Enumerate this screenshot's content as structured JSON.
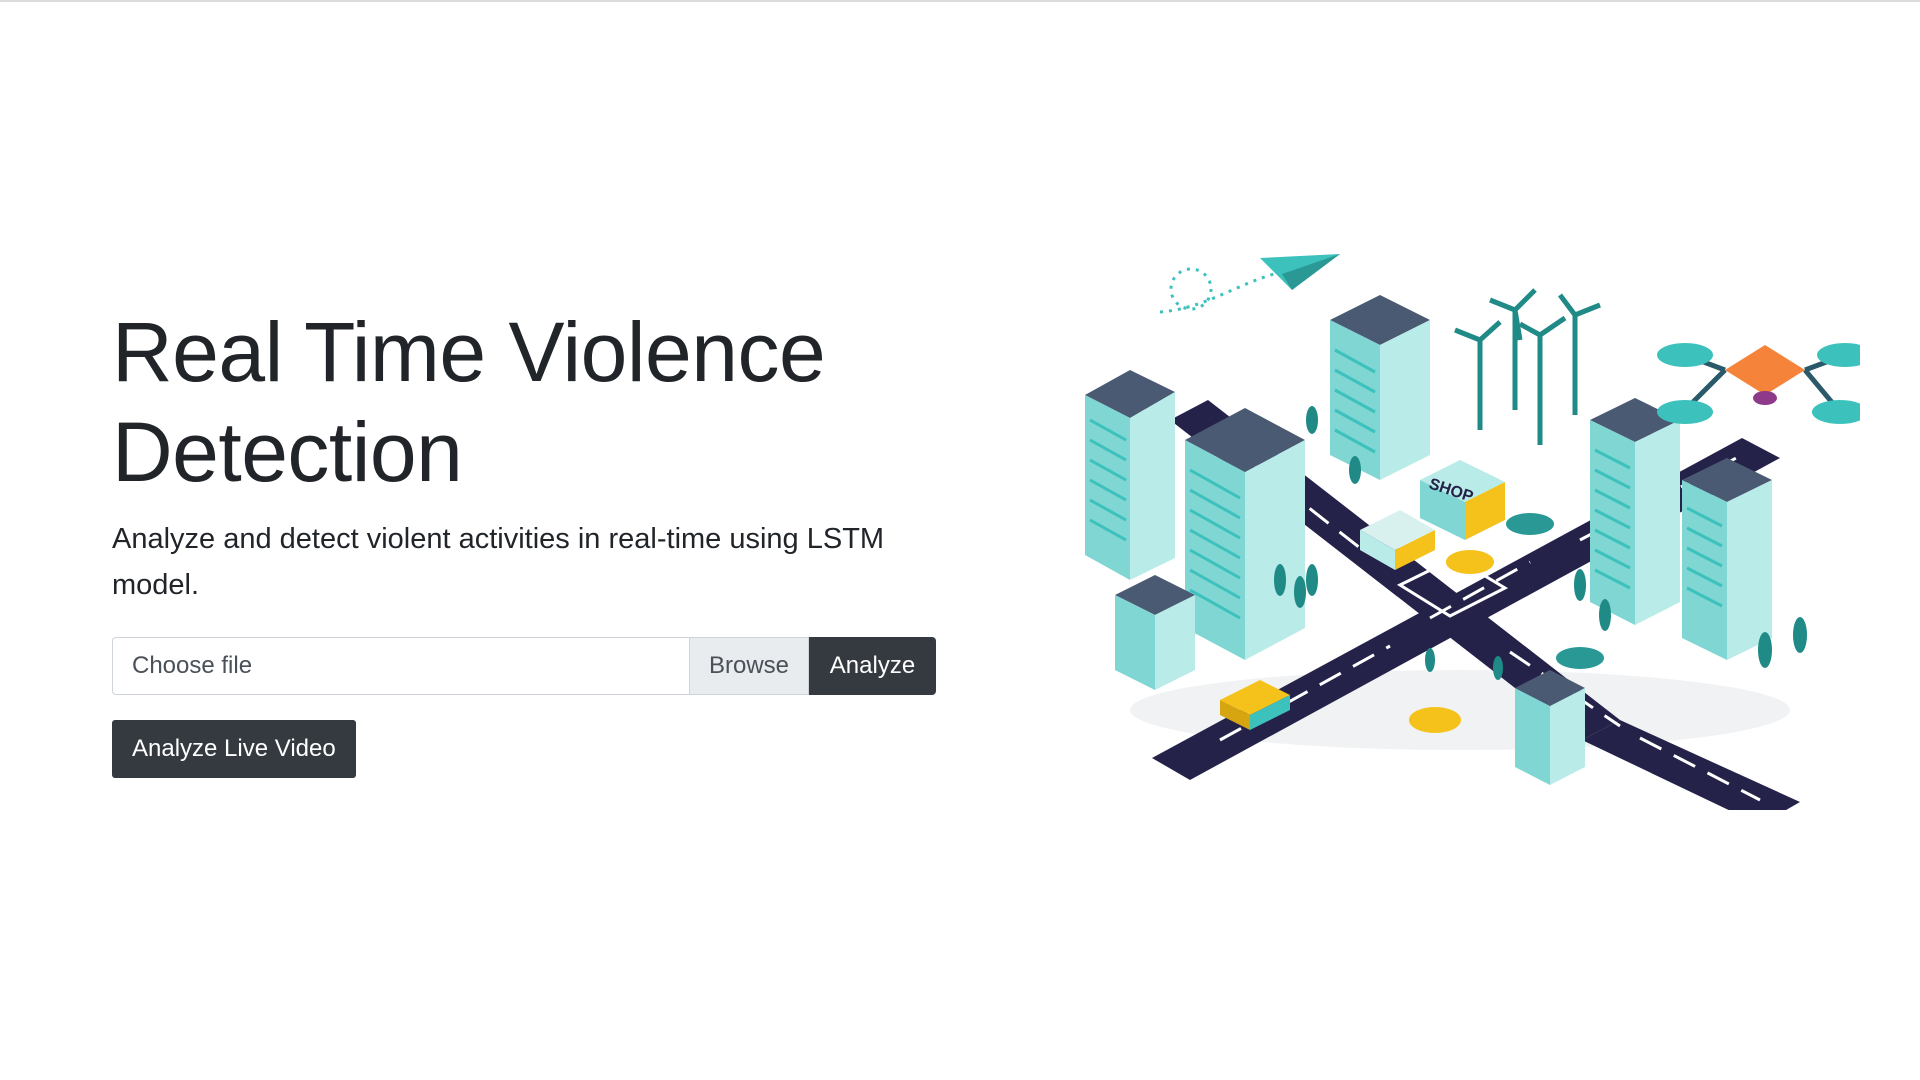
{
  "hero": {
    "title_line1": "Real Time Violence",
    "title_line2": "Detection",
    "lead": "Analyze and detect violent activities in real-time using LSTM model."
  },
  "upload": {
    "placeholder": "Choose file",
    "browse_label": "Browse",
    "analyze_label": "Analyze"
  },
  "live": {
    "button_label": "Analyze Live Video"
  },
  "illustration": {
    "shop_sign": "SHOP"
  },
  "colors": {
    "dark_button": "#343a40",
    "teal": "#3cc1bd",
    "road": "#25224a",
    "taxi_yellow": "#f5c21b",
    "drone_orange": "#f5833a"
  }
}
